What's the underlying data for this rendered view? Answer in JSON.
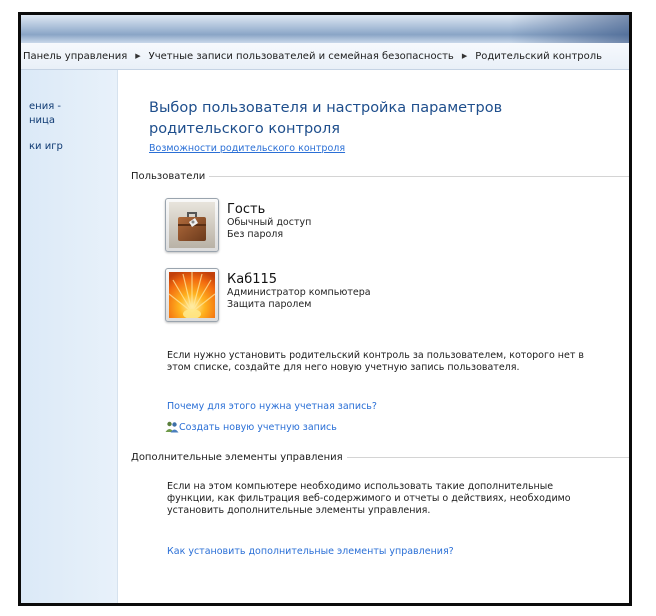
{
  "breadcrumb": {
    "items": [
      "Панель управления",
      "Учетные записи пользователей и семейная безопасность",
      "Родительский контроль"
    ]
  },
  "nav": {
    "items": [
      "ения -",
      "ница",
      "ки игр"
    ]
  },
  "main": {
    "title": "Выбор пользователя и настройка параметров родительского контроля",
    "features_link": "Возможности родительского контроля",
    "users_section": "Пользователи",
    "users": [
      {
        "name": "Гость",
        "type": "Обычный доступ",
        "password": "Без пароля",
        "icon": "briefcase-icon"
      },
      {
        "name": "Каб115",
        "type": "Администратор компьютера",
        "password": "Защита паролем",
        "icon": "flower-icon"
      }
    ],
    "no_user_text": "Если нужно установить родительский контроль за пользователем, которого нет в этом списке, создайте для него новую учетную запись пользователя.",
    "why_link": "Почему для этого нужна учетная запись?",
    "create_link": "Создать новую учетную запись",
    "additional_section": "Дополнительные элементы управления",
    "additional_text": "Если на этом компьютере необходимо использовать такие дополнительные функции, как фильтрация веб-содержимого и отчеты о действиях, необходимо установить дополнительные элементы управления.",
    "install_link": "Как установить дополнительные элементы управления?"
  },
  "colors": {
    "title_blue": "#1e4e8c",
    "link_blue": "#2a6fd6",
    "nav_bg": "#dbe9f7"
  }
}
